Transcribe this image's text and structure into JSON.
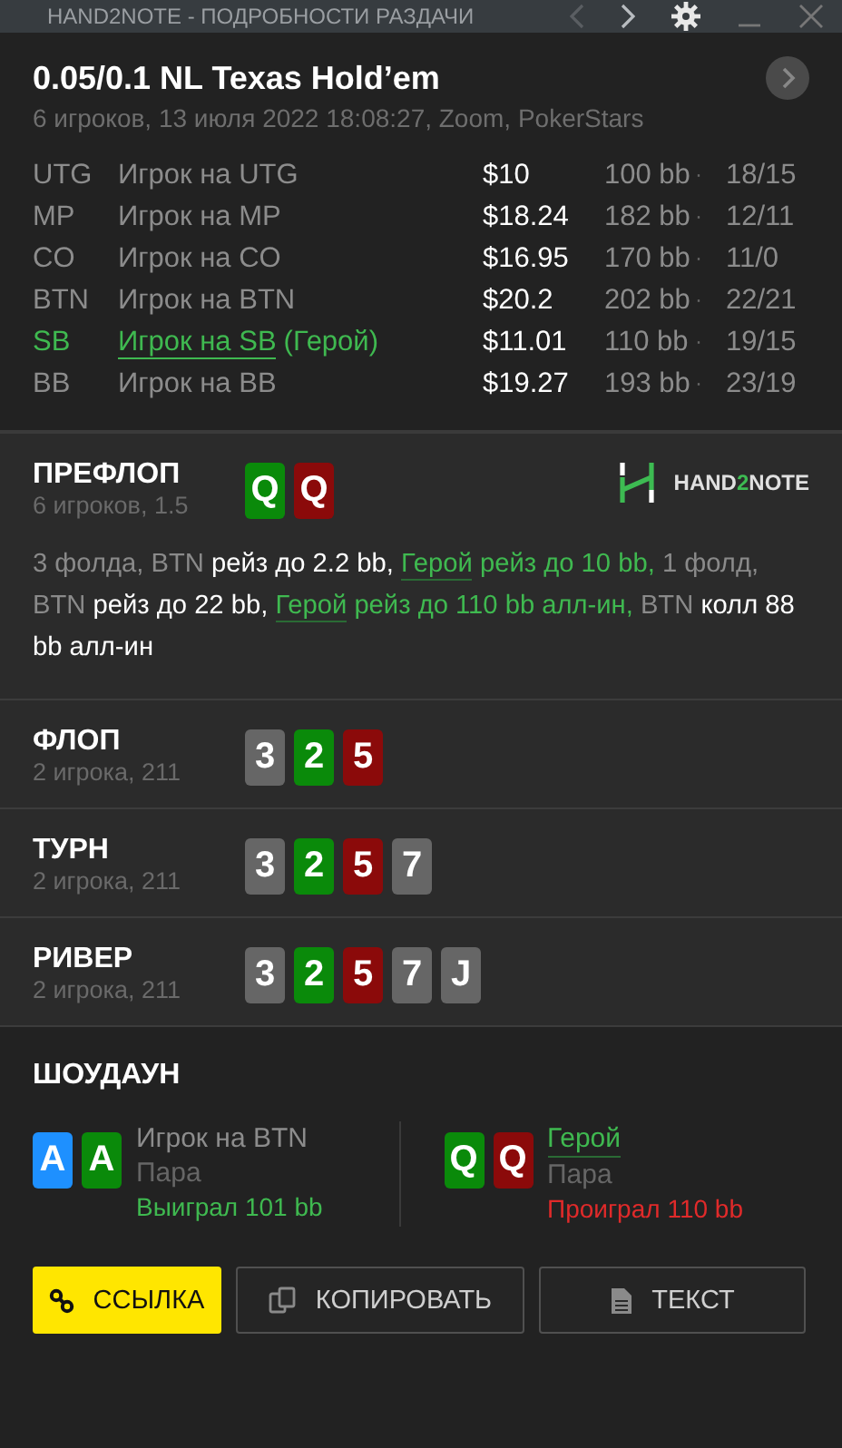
{
  "title_bar": {
    "title": "HAND2NOTE - ПОДРОБНОСТИ РАЗДАЧИ",
    "prev": {
      "disabled": true
    },
    "next": {
      "disabled": false
    }
  },
  "hand": {
    "title": "0.05/0.1 NL Texas Hold’em",
    "subtitle": "6 игроков, 13 июля 2022 18:08:27, Zoom, PokerStars"
  },
  "players": [
    {
      "position": "UTG",
      "name": "Игрок на UTG",
      "hero": false,
      "stack": "$10",
      "bb": "100 bb",
      "dot": "·",
      "stats": "18/15"
    },
    {
      "position": "MP",
      "name": "Игрок на MP",
      "hero": false,
      "stack": "$18.24",
      "bb": "182 bb",
      "dot": "·",
      "stats": "12/11"
    },
    {
      "position": "CO",
      "name": "Игрок на CO",
      "hero": false,
      "stack": "$16.95",
      "bb": "170 bb",
      "dot": "·",
      "stats": "11/0"
    },
    {
      "position": "BTN",
      "name": "Игрок на BTN",
      "hero": false,
      "stack": "$20.2",
      "bb": "202 bb",
      "dot": "·",
      "stats": "22/21"
    },
    {
      "position": "SB",
      "name": "Игрок на SB",
      "hero": true,
      "hero_tag": "(Герой)",
      "stack": "$11.01",
      "bb": "110 bb",
      "dot": "·",
      "stats": "19/15"
    },
    {
      "position": "BB",
      "name": "Игрок на BB",
      "hero": false,
      "stack": "$19.27",
      "bb": "193 bb",
      "dot": "·",
      "stats": "23/19"
    }
  ],
  "logo": [
    {
      "text": "HAND",
      "accent": false
    },
    {
      "text": "2",
      "accent": true
    },
    {
      "text": "NOTE",
      "accent": false
    }
  ],
  "streets": [
    {
      "name": "ПРЕФЛОП",
      "info": "6 игроков, 1.5",
      "logo": true,
      "cards": [
        {
          "rank": "Q",
          "color": "#0a8a0a"
        },
        {
          "rank": "Q",
          "color": "#8b0a0a"
        }
      ],
      "actions": [
        {
          "text": "3 фолда, BTN ",
          "kind": "muted"
        },
        {
          "text": "рейз до 2.2 bb, ",
          "kind": "action"
        },
        {
          "text": "Герой",
          "kind": "hero-link"
        },
        {
          "text": " рейз до 10 bb, ",
          "kind": "hero"
        },
        {
          "text": "1 фолд, BTN ",
          "kind": "muted"
        },
        {
          "text": "рейз до 22 bb, ",
          "kind": "action"
        },
        {
          "text": "Герой",
          "kind": "hero-link"
        },
        {
          "text": " рейз до 110 bb алл-ин, ",
          "kind": "hero"
        },
        {
          "text": "BTN ",
          "kind": "muted"
        },
        {
          "text": "колл 88 bb алл-ин",
          "kind": "action"
        }
      ]
    },
    {
      "name": "ФЛОП",
      "info": "2 игрока, 211",
      "logo": false,
      "cards": [
        {
          "rank": "3",
          "color": "#666666"
        },
        {
          "rank": "2",
          "color": "#0a8a0a"
        },
        {
          "rank": "5",
          "color": "#8b0a0a"
        }
      ]
    },
    {
      "name": "ТУРН",
      "info": "2 игрока, 211",
      "logo": false,
      "cards": [
        {
          "rank": "3",
          "color": "#666666"
        },
        {
          "rank": "2",
          "color": "#0a8a0a"
        },
        {
          "rank": "5",
          "color": "#8b0a0a"
        },
        {
          "rank": "7",
          "color": "#666666"
        }
      ]
    },
    {
      "name": "РИВЕР",
      "info": "2 игрока, 211",
      "logo": false,
      "cards": [
        {
          "rank": "3",
          "color": "#666666"
        },
        {
          "rank": "2",
          "color": "#0a8a0a"
        },
        {
          "rank": "5",
          "color": "#8b0a0a"
        },
        {
          "rank": "7",
          "color": "#666666"
        },
        {
          "rank": "J",
          "color": "#666666"
        }
      ]
    }
  ],
  "showdown": {
    "title": "ШОУДАУН",
    "players": [
      {
        "name": "Игрок на BTN",
        "hero": false,
        "hand": "Пара",
        "result": "Выиграл 101 bb",
        "won": true,
        "cards": [
          {
            "rank": "A",
            "color": "#1e90ff"
          },
          {
            "rank": "A",
            "color": "#0a8a0a"
          }
        ]
      },
      {
        "name": "Герой",
        "hero": true,
        "hand": "Пара",
        "result": "Проиграл 110 bb",
        "won": false,
        "cards": [
          {
            "rank": "Q",
            "color": "#0a8a0a"
          },
          {
            "rank": "Q",
            "color": "#8b0a0a"
          }
        ]
      }
    ]
  },
  "buttons": [
    {
      "label": "ССЫЛКА",
      "kind": "link",
      "primary": true
    },
    {
      "label": "КОПИРОВАТЬ",
      "kind": "copy",
      "primary": false
    },
    {
      "label": "ТЕКСТ",
      "kind": "text",
      "primary": false
    }
  ]
}
